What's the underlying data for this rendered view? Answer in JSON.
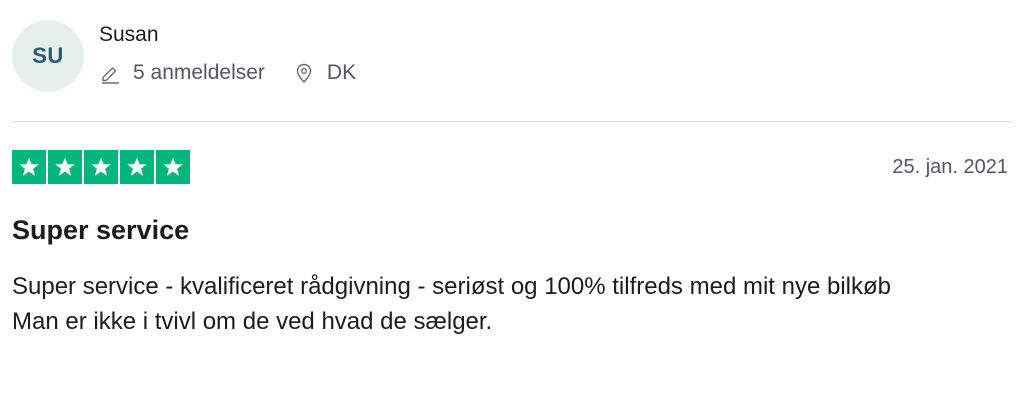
{
  "consumer": {
    "initials": "SU",
    "name": "Susan",
    "reviews_count": "5 anmeldelser",
    "location": "DK",
    "avatar_bg": "#e5efec",
    "avatar_fg": "#2b5c6b"
  },
  "review": {
    "rating": 5,
    "max_rating": 5,
    "star_color": "#00b67a",
    "date": "25. jan. 2021",
    "title": "Super service",
    "body_lines": [
      "Super service - kvalificeret rådgivning - seriøst og 100% tilfreds med mit nye bilkøb",
      "Man er ikke i tvivl om de ved hvad de sælger."
    ]
  },
  "icons": {
    "reviews": "pencil-icon",
    "location": "location-pin-icon",
    "star": "star-icon"
  }
}
